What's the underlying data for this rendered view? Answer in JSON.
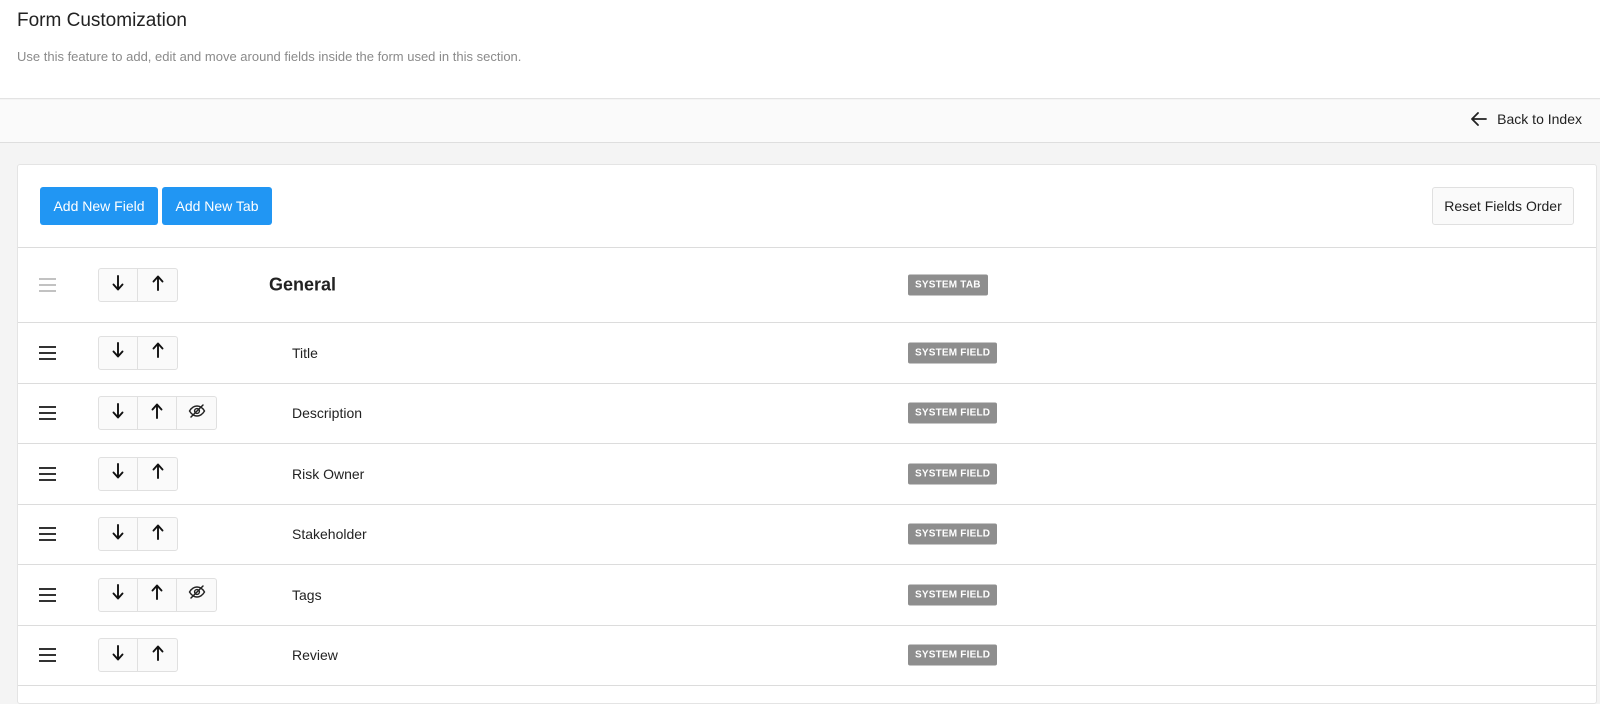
{
  "header": {
    "title": "Form Customization",
    "subtitle": "Use this feature to add, edit and move around fields inside the form used in this section."
  },
  "toolbar": {
    "back_label": "Back to Index"
  },
  "actions": {
    "add_field_label": "Add New Field",
    "add_tab_label": "Add New Tab",
    "reset_label": "Reset Fields Order"
  },
  "colors": {
    "primary": "#2196f3",
    "badge": "#8e8e8e"
  },
  "rows": [
    {
      "label": "General",
      "badge": "SYSTEM TAB",
      "kind": "tab",
      "hideable": false
    },
    {
      "label": "Title",
      "badge": "SYSTEM FIELD",
      "kind": "field",
      "hideable": false
    },
    {
      "label": "Description",
      "badge": "SYSTEM FIELD",
      "kind": "field",
      "hideable": true
    },
    {
      "label": "Risk Owner",
      "badge": "SYSTEM FIELD",
      "kind": "field",
      "hideable": false
    },
    {
      "label": "Stakeholder",
      "badge": "SYSTEM FIELD",
      "kind": "field",
      "hideable": false
    },
    {
      "label": "Tags",
      "badge": "SYSTEM FIELD",
      "kind": "field",
      "hideable": true
    },
    {
      "label": "Review",
      "badge": "SYSTEM FIELD",
      "kind": "field",
      "hideable": false
    }
  ]
}
